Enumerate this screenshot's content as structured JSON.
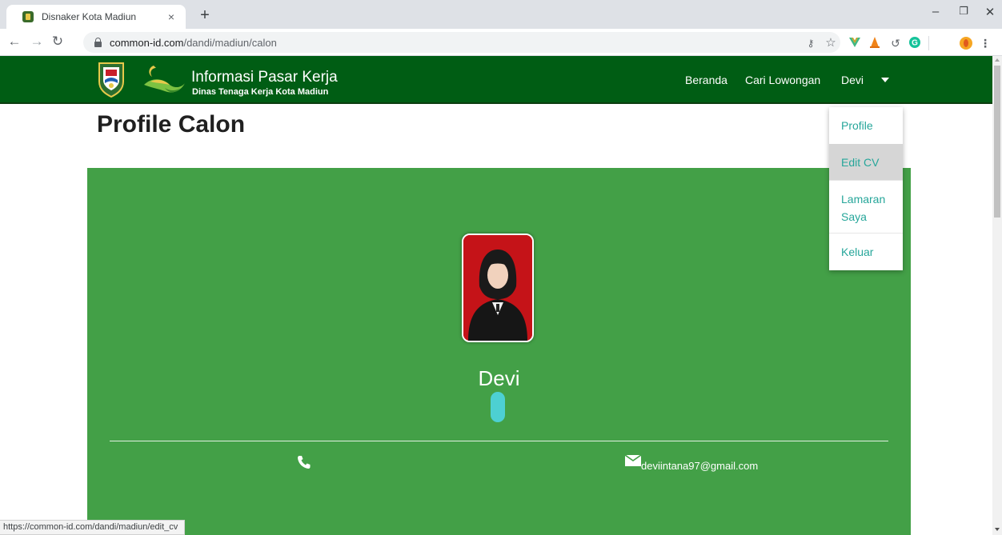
{
  "browser": {
    "tab_title": "Disnaker Kota Madiun",
    "tab_close": "×",
    "new_tab": "+",
    "url_host": "common-id.com",
    "url_path": "/dandi/madiun/calon",
    "status_url": "https://common-id.com/dandi/madiun/edit_cv",
    "window_controls": [
      "–",
      "❐",
      "✕"
    ],
    "nav_icons": [
      "back-icon",
      "forward-icon",
      "reload-icon"
    ],
    "extension_icons": [
      "key-icon",
      "star-icon",
      "vuejs-icon",
      "vlc-icon",
      "history-icon",
      "grammarly-icon",
      "profile-icon",
      "menu-icon"
    ]
  },
  "site": {
    "brand_title": "Informasi Pasar Kerja",
    "brand_subtitle": "Dinas Tenaga Kerja Kota Madiun",
    "nav": {
      "home": "Beranda",
      "search_jobs": "Cari Lowongan",
      "user": "Devi"
    },
    "colors": {
      "navbar": "#005d14",
      "card": "#43a047",
      "dropdown_link": "#26a69a",
      "status_pill": "#4dd0d2"
    }
  },
  "user_menu": {
    "items": [
      "Profile",
      "Edit CV",
      "Lamaran Saya",
      "Keluar"
    ],
    "hovered": "Edit CV"
  },
  "page": {
    "title": "Profile Calon"
  },
  "profile": {
    "name": "Devi",
    "email": "deviintana97@gmail.com",
    "phone": ""
  }
}
